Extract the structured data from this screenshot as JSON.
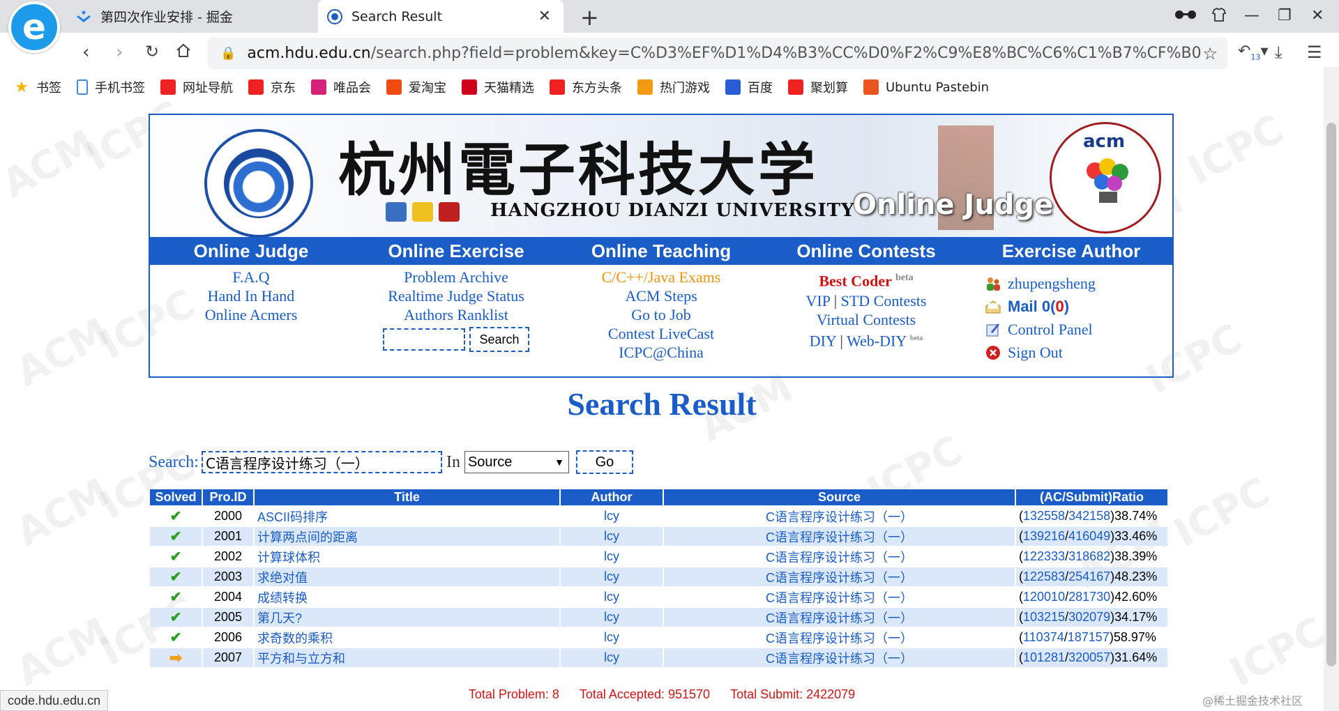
{
  "browser": {
    "tabs": [
      {
        "label": "第四次作业安排 - 掘金",
        "active": false
      },
      {
        "label": "Search Result",
        "active": true
      }
    ],
    "url_host": "acm.hdu.edu.cn",
    "url_path": "/search.php?field=problem&key=C%D3%EF%D1%D4%B3%CC%D0%F2%C9%E8%BC%C6%C1%B7%CF%B0%A3%A8...",
    "logo_glyph": "e",
    "download_badge": "13"
  },
  "bookmarks": [
    {
      "label": "书签",
      "icon": "star-icon",
      "color": "#f5b400"
    },
    {
      "label": "手机书签",
      "icon": "phone-icon",
      "color": "#3a8be0"
    },
    {
      "label": "网址导航",
      "icon": "nav-icon",
      "color": "#e22"
    },
    {
      "label": "京东",
      "icon": "jd-icon",
      "color": "#e22"
    },
    {
      "label": "唯品会",
      "icon": "vip-icon",
      "color": "#d6227a"
    },
    {
      "label": "爱淘宝",
      "icon": "taobao-icon",
      "color": "#f04a10"
    },
    {
      "label": "天猫精选",
      "icon": "tmall-icon",
      "color": "#d0021b"
    },
    {
      "label": "东方头条",
      "icon": "toutiao-icon",
      "color": "#e22"
    },
    {
      "label": "热门游戏",
      "icon": "game-icon",
      "color": "#f59a10"
    },
    {
      "label": "百度",
      "icon": "baidu-icon",
      "color": "#2a5cd6"
    },
    {
      "label": "聚划算",
      "icon": "juhuasuan-icon",
      "color": "#e22"
    },
    {
      "label": "Ubuntu Pastebin",
      "icon": "ubuntu-icon",
      "color": "#e95420"
    }
  ],
  "banner": {
    "cn_title": "杭州電子科技大学",
    "en_title": "HANGZHOU DIANZI UNIVERSITY",
    "oj_title": "Online Judge",
    "acm_text": "acm"
  },
  "nav": {
    "online_judge": {
      "title": "Online Judge",
      "links": [
        "F.A.Q",
        "Hand In Hand",
        "Online Acmers"
      ]
    },
    "online_exercise": {
      "title": "Online Exercise",
      "links": [
        "Problem Archive",
        "Realtime Judge Status",
        "Authors Ranklist"
      ],
      "search_button": "Search"
    },
    "online_teaching": {
      "title": "Online Teaching",
      "links": [
        "C/C++/Java Exams",
        "ACM Steps",
        "Go to Job",
        "Contest LiveCast",
        "ICPC@China"
      ]
    },
    "online_contests": {
      "title": "Online Contests",
      "best_coder": "Best Coder",
      "beta": "beta",
      "vip": "VIP",
      "sep": "|",
      "std": "STD Contests",
      "virtual": "Virtual Contests",
      "diy": "DIY",
      "web_diy": "Web-DIY",
      "beta2": "beta"
    },
    "exercise_author": {
      "title": "Exercise Author",
      "username": "zhupengsheng",
      "mail_label": "Mail 0(",
      "mail_count": "0",
      "mail_close": ")",
      "control_panel": "Control Panel",
      "sign_out": "Sign Out"
    }
  },
  "result_title": "Search Result",
  "search": {
    "label": "Search:",
    "value": "C语言程序设计练习（一）",
    "in_label": "In",
    "field": "Source",
    "go_label": "Go"
  },
  "table": {
    "headers": [
      "Solved",
      "Pro.ID",
      "Title",
      "Author",
      "Source",
      "(AC/Submit)Ratio"
    ],
    "rows": [
      {
        "solved": true,
        "id": "2000",
        "title": "ASCII码排序",
        "author": "lcy",
        "source": "C语言程序设计练习（一）",
        "ac": "132558",
        "submit": "342158",
        "ratio": "38.74%"
      },
      {
        "solved": true,
        "id": "2001",
        "title": "计算两点间的距离",
        "author": "lcy",
        "source": "C语言程序设计练习（一）",
        "ac": "139216",
        "submit": "416049",
        "ratio": "33.46%"
      },
      {
        "solved": true,
        "id": "2002",
        "title": "计算球体积",
        "author": "lcy",
        "source": "C语言程序设计练习（一）",
        "ac": "122333",
        "submit": "318682",
        "ratio": "38.39%"
      },
      {
        "solved": true,
        "id": "2003",
        "title": "求绝对值",
        "author": "lcy",
        "source": "C语言程序设计练习（一）",
        "ac": "122583",
        "submit": "254167",
        "ratio": "48.23%"
      },
      {
        "solved": true,
        "id": "2004",
        "title": "成绩转换",
        "author": "lcy",
        "source": "C语言程序设计练习（一）",
        "ac": "120010",
        "submit": "281730",
        "ratio": "42.60%"
      },
      {
        "solved": true,
        "id": "2005",
        "title": "第几天?",
        "author": "lcy",
        "source": "C语言程序设计练习（一）",
        "ac": "103215",
        "submit": "302079",
        "ratio": "34.17%"
      },
      {
        "solved": true,
        "id": "2006",
        "title": "求奇数的乘积",
        "author": "lcy",
        "source": "C语言程序设计练习（一）",
        "ac": "110374",
        "submit": "187157",
        "ratio": "58.97%"
      },
      {
        "solved": false,
        "id": "2007",
        "title": "平方和与立方和",
        "author": "lcy",
        "source": "C语言程序设计练习（一）",
        "ac": "101281",
        "submit": "320057",
        "ratio": "31.64%"
      }
    ]
  },
  "totals": {
    "problem": "Total Problem: 8",
    "accepted": "Total Accepted: 951570",
    "submit": "Total Submit: 2422079"
  },
  "status_url": "code.hdu.edu.cn",
  "corner_watermark": "@稀土掘金技术社区",
  "colors": {
    "brand_blue": "#1a5cc8",
    "row_alt": "#dbe8fa",
    "totals_red": "#d01414"
  }
}
